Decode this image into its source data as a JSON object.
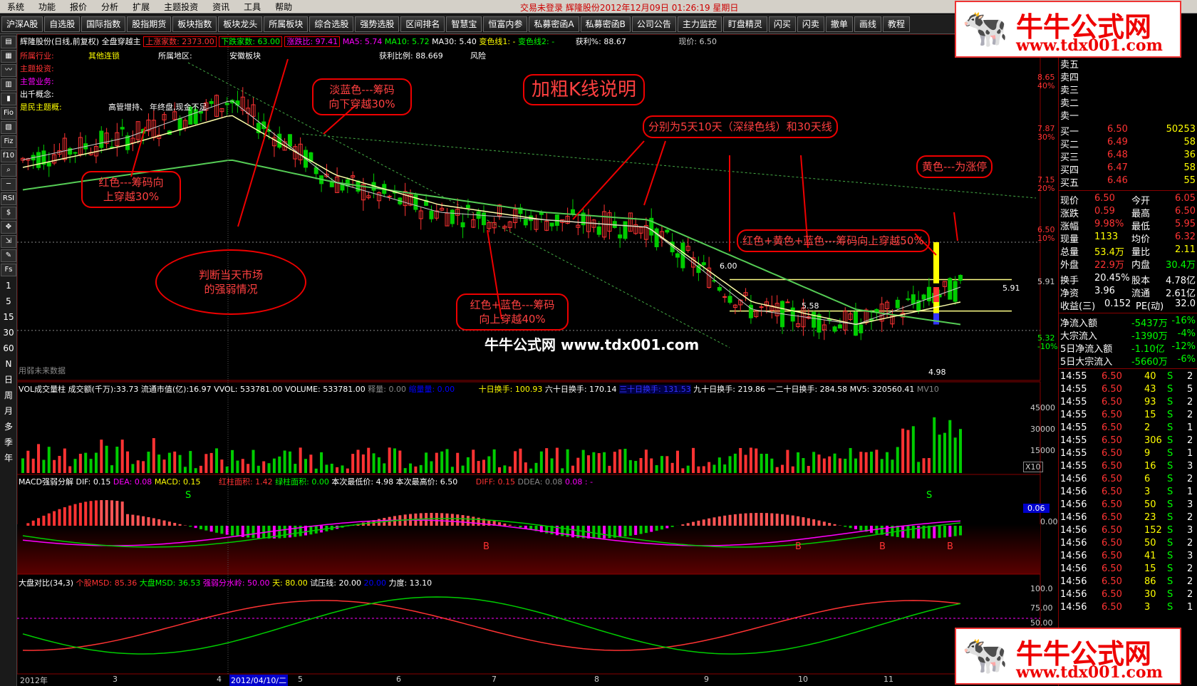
{
  "menu": {
    "items": [
      "系统",
      "功能",
      "报价",
      "分析",
      "扩展",
      "主题投资",
      "资讯",
      "工具",
      "帮助"
    ],
    "status": "交易未登录  辉隆股份2012年12月09日 01:26:19 星期日"
  },
  "toolbar": {
    "buttons": [
      "沪深A股",
      "自选股",
      "国际指数",
      "股指期货",
      "板块指数",
      "板块龙头",
      "所属板块",
      "综合选股",
      "强势选股",
      "区间排名",
      "智慧宝",
      "恒富内参",
      "私募密函A",
      "私募密函B",
      "公司公告",
      "主力监控",
      "盯盘精灵",
      "闪买",
      "闪卖",
      "撤单",
      "画线",
      "教程"
    ]
  },
  "left_toolbar": {
    "icons": [
      "Fio",
      "Fiz",
      "f10",
      "RSI",
      "$"
    ],
    "periods": [
      "1",
      "5",
      "15",
      "30",
      "60",
      "N",
      "日",
      "周",
      "月",
      "多",
      "季",
      "年"
    ]
  },
  "kline": {
    "header": "辉隆股份(日线,前复权) 全盘穿越主",
    "up_count": "上涨家数: 2373.00",
    "down_count": "下跌家数: 63.00",
    "ratio": "涨跌比: 97.41",
    "ma5": "MA5: 5.74",
    "ma10": "MA10: 5.72",
    "ma30": "MA30: 5.40",
    "cross1": "变色线1: -",
    "cross2": "变色线2: -",
    "profit": "获利%: 88.67",
    "price": "现价: 6.50",
    "profit_ratio": "获利比例: 88.669",
    "risk": "风险",
    "industry_label": "所属行业:",
    "industry_val": "其他连锁",
    "region_label": "所属地区:",
    "region_val": "安徽板块",
    "theme_label": "主题投资:",
    "business_label": "主营业务:",
    "concept_label": "出千概念:",
    "tag1": "高管增持、",
    "tag2": "年终盘,现金不足",
    "tag3": "是民主题概:",
    "source": "用弱未来数据",
    "high_label": "6.00",
    "mid_label": "5.58",
    "low_label": "4.98",
    "last_label": "5.91"
  },
  "axis_right": {
    "kline": [
      {
        "value": "8.65",
        "pct": "40%"
      },
      {
        "value": "7.87",
        "pct": "30%"
      },
      {
        "value": "7.15",
        "pct": "20%"
      },
      {
        "value": "6.50",
        "pct": "10%"
      },
      {
        "value": "5.91",
        "pct": ""
      },
      {
        "value": "5.32",
        "pct": "-10%"
      }
    ],
    "volume": [
      "45000",
      "30000",
      "15000"
    ],
    "vol_unit": "X10",
    "macd": [
      "0.06",
      "0.00"
    ],
    "msd": [
      "100.0",
      "75.00",
      "50.00"
    ]
  },
  "volume": {
    "header": "VOL成交量柱 成交额(千万):33.73 流通市值(亿):16.97 VVOL: 533781.00  VOLUME: 533781.00",
    "extra1": "释量: 0.00",
    "extra2": "缩量量: 0.00",
    "turnover10": "十日换手: 100.93",
    "turnover60": "六十日换手: 170.14",
    "turnover30": "三十日换手: 131.53",
    "turnover90": "九十日换手: 219.86",
    "turnover120": "一二十日换手: 284.58",
    "mv5": "MV5: 320560.41",
    "mv10": "MV10"
  },
  "macd": {
    "header": "MACD强弱分解  DIF: 0.15",
    "dea": "DEA: 0.08",
    "macd": "MACD: 0.15",
    "red_area": "红柱面积: 1.42",
    "green_area": "绿柱面积: 0.00",
    "low": "本次最低价: 4.98",
    "high": "本次最高价: 6.50",
    "diff": "DIFF: 0.15",
    "ddea": "DDEA: 0.08",
    "ddea2": "0.08 : -",
    "s": "S",
    "b": "B"
  },
  "msd": {
    "header": "大盘对比(34,3)",
    "stock": "个股MSD: 85.36",
    "market": "大盘MSD: 36.53",
    "water": "强弱分水岭: 50.00",
    "sky": "天: 80.00",
    "test": "试压线: 20.00",
    "test2": "20.00",
    "force": "力度: 13.10"
  },
  "xaxis": {
    "labels": [
      "2012年",
      "3",
      "4",
      "2012/04/10/二",
      "5",
      "6",
      "7",
      "8",
      "9",
      "10",
      "11"
    ]
  },
  "callouts": {
    "title": "加粗K线说明",
    "red30": "红色---筹码向\n上穿越30%",
    "market": "判断当天市场\n的强弱情况",
    "blue30": "淡蓝色---筹码\n向下穿越30%",
    "redblue40": "红色+蓝色---筹码\n向上穿越40%",
    "ma": "分别为5天10天（深绿色线）和30天线",
    "rgb50": "红色+黄色+蓝色---筹码向上穿越50%",
    "yellow": "黄色---为涨停"
  },
  "watermark": "牛牛公式网  www.tdx001.com",
  "logo": {
    "name": "牛牛公式网",
    "url": "www.tdx001.com"
  },
  "orderbook": {
    "sells": [
      {
        "label": "卖五"
      },
      {
        "label": "卖四"
      },
      {
        "label": "卖三"
      },
      {
        "label": "卖二"
      },
      {
        "label": "卖一"
      }
    ],
    "buys": [
      {
        "label": "买一",
        "price": "6.50",
        "vol": "50253"
      },
      {
        "label": "买二",
        "price": "6.49",
        "vol": "58"
      },
      {
        "label": "买三",
        "price": "6.48",
        "vol": "36"
      },
      {
        "label": "买四",
        "price": "6.47",
        "vol": "58"
      },
      {
        "label": "买五",
        "price": "6.46",
        "vol": "55"
      }
    ]
  },
  "quote": [
    {
      "k1": "现价",
      "v1": "6.50",
      "k2": "今开",
      "v2": "6.05"
    },
    {
      "k1": "涨跌",
      "v1": "0.59",
      "k2": "最高",
      "v2": "6.50"
    },
    {
      "k1": "涨幅",
      "v1": "9.98%",
      "k2": "最低",
      "v2": "5.95"
    },
    {
      "k1": "现量",
      "v1": "1133",
      "k2": "均价",
      "v2": "6.32"
    },
    {
      "k1": "总量",
      "v1": "53.4万",
      "k2": "量比",
      "v2": "2.11"
    },
    {
      "k1": "外盘",
      "v1": "22.9万",
      "k2": "内盘",
      "v2": "30.4万"
    },
    {
      "k1": "换手",
      "v1": "20.45%",
      "k2": "股本",
      "v2": "4.78亿"
    },
    {
      "k1": "净资",
      "v1": "3.96",
      "k2": "流通",
      "v2": "2.61亿"
    },
    {
      "k1": "收益(三)",
      "v1": "0.152",
      "k2": "PE(动)",
      "v2": "32.0"
    }
  ],
  "flows": [
    {
      "k": "净流入额",
      "v": "-5437万",
      "p": "-16%"
    },
    {
      "k": "大宗流入",
      "v": "-1390万",
      "p": "-4%"
    },
    {
      "k": "5日净流入额",
      "v": "-1.10亿",
      "p": "-12%"
    },
    {
      "k": "5日大宗流入",
      "v": "-5660万",
      "p": "-6%"
    }
  ],
  "ticks": [
    {
      "t": "14:55",
      "p": "6.50",
      "v": "40",
      "s": "S",
      "n": "2"
    },
    {
      "t": "14:55",
      "p": "6.50",
      "v": "43",
      "s": "S",
      "n": "5"
    },
    {
      "t": "14:55",
      "p": "6.50",
      "v": "93",
      "s": "S",
      "n": "2"
    },
    {
      "t": "14:55",
      "p": "6.50",
      "v": "15",
      "s": "S",
      "n": "2"
    },
    {
      "t": "14:55",
      "p": "6.50",
      "v": "2",
      "s": "S",
      "n": "1"
    },
    {
      "t": "14:55",
      "p": "6.50",
      "v": "306",
      "s": "S",
      "n": "2"
    },
    {
      "t": "14:55",
      "p": "6.50",
      "v": "9",
      "s": "S",
      "n": "1"
    },
    {
      "t": "14:55",
      "p": "6.50",
      "v": "16",
      "s": "S",
      "n": "3"
    },
    {
      "t": "14:56",
      "p": "6.50",
      "v": "6",
      "s": "S",
      "n": "2"
    },
    {
      "t": "14:56",
      "p": "6.50",
      "v": "3",
      "s": "S",
      "n": "1"
    },
    {
      "t": "14:56",
      "p": "6.50",
      "v": "50",
      "s": "S",
      "n": "3"
    },
    {
      "t": "14:56",
      "p": "6.50",
      "v": "23",
      "s": "S",
      "n": "2"
    },
    {
      "t": "14:56",
      "p": "6.50",
      "v": "152",
      "s": "S",
      "n": "3"
    },
    {
      "t": "14:56",
      "p": "6.50",
      "v": "50",
      "s": "S",
      "n": "2"
    },
    {
      "t": "14:56",
      "p": "6.50",
      "v": "41",
      "s": "S",
      "n": "3"
    },
    {
      "t": "14:56",
      "p": "6.50",
      "v": "15",
      "s": "S",
      "n": "2"
    },
    {
      "t": "14:56",
      "p": "6.50",
      "v": "86",
      "s": "S",
      "n": "2"
    },
    {
      "t": "14:56",
      "p": "6.50",
      "v": "30",
      "s": "S",
      "n": "2"
    },
    {
      "t": "14:56",
      "p": "6.50",
      "v": "3",
      "s": "S",
      "n": "1"
    }
  ],
  "chart_data": {
    "type": "line",
    "x": [
      "2012年",
      "3",
      "4",
      "5",
      "6",
      "7",
      "8",
      "9",
      "10",
      "11"
    ],
    "series": [
      {
        "name": "MA5",
        "values": [
          7.6,
          7.9,
          8.4,
          7.3,
          6.9,
          6.8,
          6.7,
          5.6,
          5.4,
          5.9
        ]
      },
      {
        "name": "MA10",
        "values": [
          7.5,
          7.8,
          8.2,
          7.4,
          7.0,
          6.8,
          6.7,
          5.7,
          5.4,
          5.7
        ]
      },
      {
        "name": "MA30",
        "values": [
          7.2,
          7.4,
          7.6,
          7.3,
          7.1,
          6.9,
          6.8,
          6.2,
          5.6,
          5.4
        ]
      }
    ],
    "ylim": [
      4.9,
      8.9
    ]
  }
}
